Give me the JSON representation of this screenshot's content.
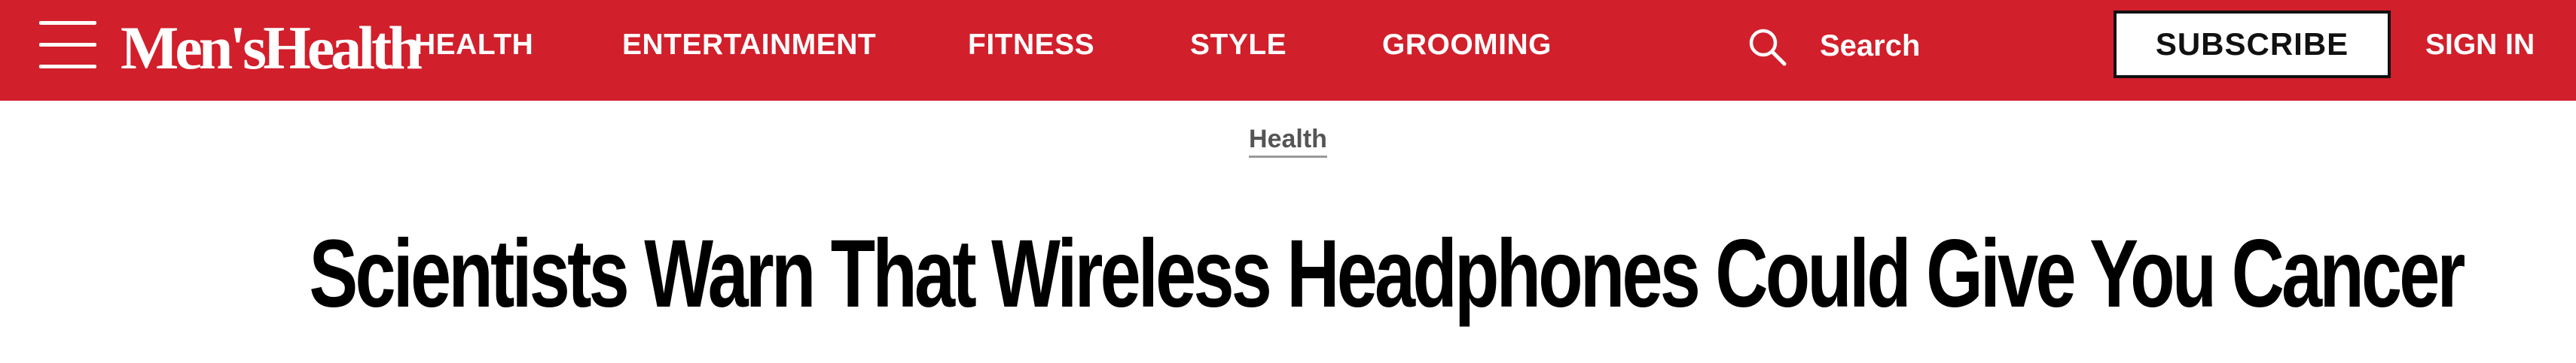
{
  "header": {
    "menu_icon": "hamburger-menu-icon",
    "logo_text": "Men'sHealth",
    "nav_links": [
      "HEALTH",
      "ENTERTAINMENT",
      "FITNESS",
      "STYLE",
      "GROOMING"
    ],
    "search": {
      "icon": "search-icon",
      "label": "Search"
    },
    "subscribe_label": "SUBSCRIBE",
    "signin_label": "SIGN IN"
  },
  "article": {
    "category": "Health",
    "headline": "Scientists Warn That Wireless Headphones Could Give You Cancer"
  },
  "colors": {
    "brand_red": "#d11f2b",
    "text_black": "#000000",
    "category_gray": "#555555"
  }
}
